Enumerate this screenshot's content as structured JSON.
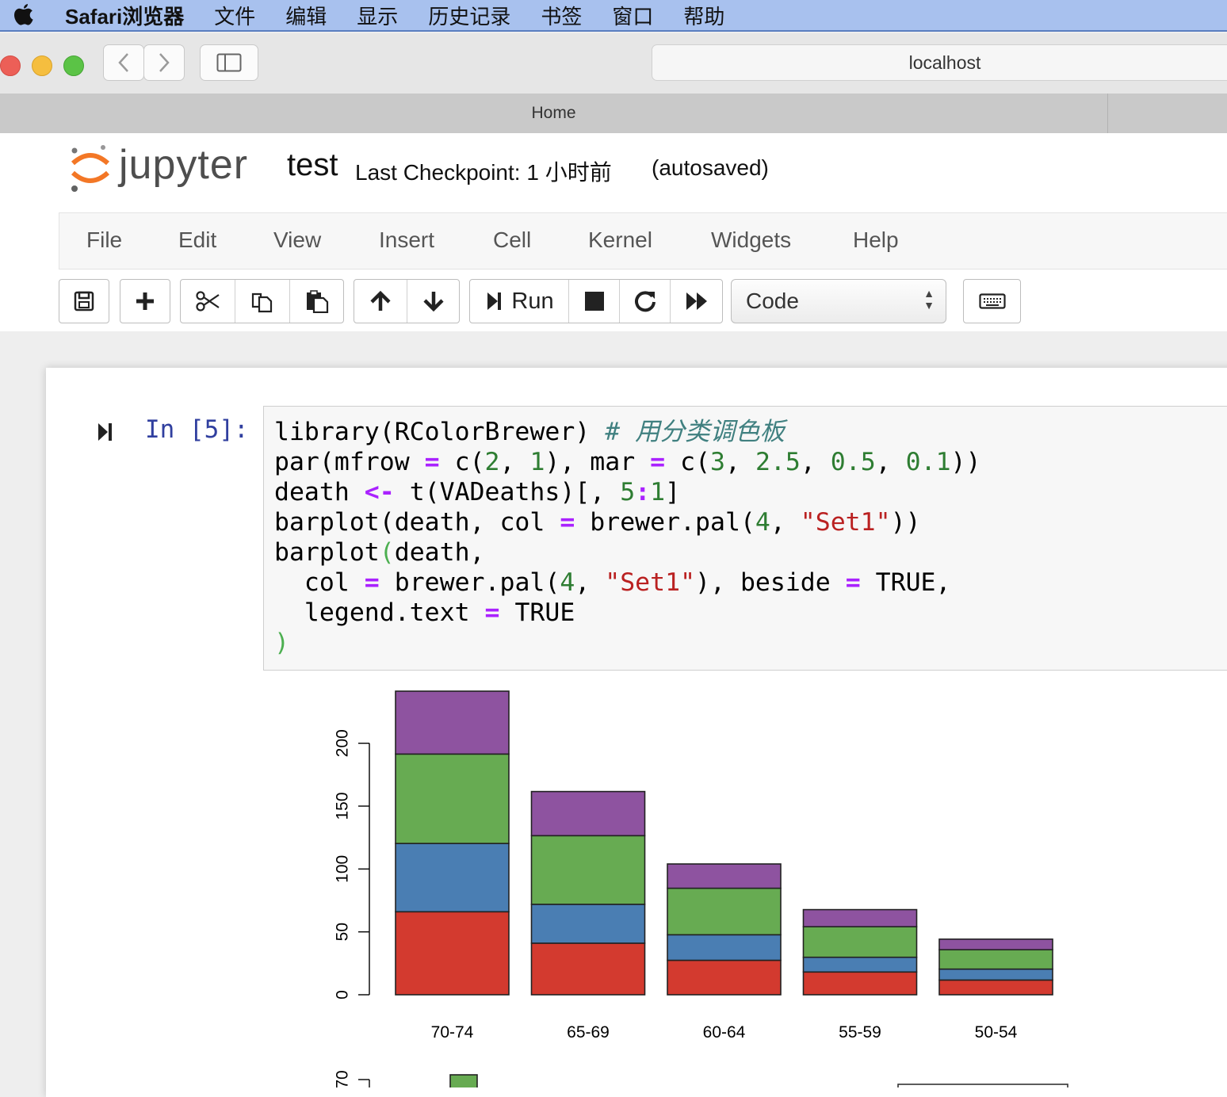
{
  "mac_menu": {
    "app": "Safari浏览器",
    "items": [
      "文件",
      "编辑",
      "显示",
      "历史记录",
      "书签",
      "窗口",
      "帮助"
    ]
  },
  "browser": {
    "address": "localhost",
    "tab_title": "Home"
  },
  "jupyter": {
    "logo_text": "jupyter",
    "notebook_name": "test",
    "checkpoint": "Last Checkpoint: 1 小时前",
    "autosave": "(autosaved)",
    "menu": [
      "File",
      "Edit",
      "View",
      "Insert",
      "Cell",
      "Kernel",
      "Widgets",
      "Help"
    ],
    "run_label": "Run",
    "cell_type": "Code"
  },
  "cell": {
    "prompt": "In [5]:",
    "code_lines": [
      "library(RColorBrewer) # 用分类调色板",
      "par(mfrow = c(2, 1), mar = c(3, 2.5, 0.5, 0.1))",
      "death <- t(VADeaths)[, 5:1]",
      "barplot(death, col = brewer.pal(4, \"Set1\"))",
      "barplot(death,",
      "  col = brewer.pal(4, \"Set1\"), beside = TRUE,",
      "  legend.text = TRUE",
      ")"
    ]
  },
  "colors": {
    "red": "#d33a2f",
    "blue": "#4a7eb3",
    "green": "#67ab52",
    "purple": "#8e53a0"
  },
  "chart_data": [
    {
      "type": "bar",
      "stacked": true,
      "categories": [
        "70-74",
        "65-69",
        "60-64",
        "55-59",
        "50-54"
      ],
      "series": [
        {
          "values": [
            66.0,
            41.0,
            27.4,
            18.1,
            11.7
          ],
          "color": "#d33a2f"
        },
        {
          "values": [
            54.3,
            30.9,
            20.3,
            11.7,
            8.7
          ],
          "color": "#4a7eb3"
        },
        {
          "values": [
            71.1,
            54.6,
            37.0,
            24.3,
            15.4
          ],
          "color": "#67ab52"
        },
        {
          "values": [
            50.0,
            35.1,
            19.3,
            13.6,
            8.4
          ],
          "color": "#8e53a0"
        }
      ],
      "yticks": [
        "0",
        "50",
        "100",
        "150",
        "200"
      ],
      "ylim": [
        0,
        241.4
      ]
    },
    {
      "type": "bar",
      "partial": true,
      "yticks": [
        "70"
      ]
    }
  ]
}
